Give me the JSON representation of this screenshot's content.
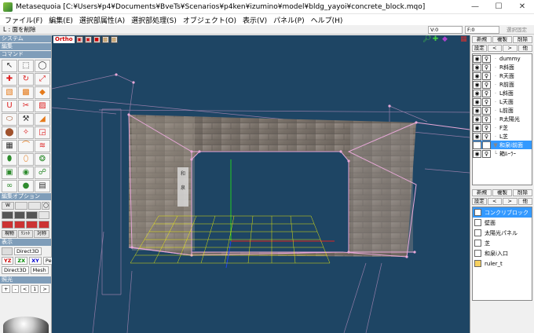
{
  "window": {
    "title": "Metasequoia [C:¥Users¥p4¥Documents¥BveTs¥Scenarios¥p4ken¥izumino¥model¥bldg_yayoi¥concrete_block.mqo]",
    "minimize_icon": "minimize-icon",
    "maximize_icon": "maximize-icon",
    "close_icon": "close-icon"
  },
  "menubar": {
    "items": [
      "ファイル(F)",
      "編集(E)",
      "選択部属性(A)",
      "選択部処理(S)",
      "オブジェクト(O)",
      "表示(V)",
      "パネル(P)",
      "ヘルプ(H)"
    ]
  },
  "statusbar": {
    "text": "L : 面を削除",
    "field_v": "V:0",
    "field_f": "F:0",
    "lock_label": "選択固定"
  },
  "left_panel": {
    "sections": {
      "system": "システム",
      "edit": "編集",
      "command": "コマンド",
      "edit_option": "編集オプション",
      "display": "表示",
      "lighting": "照光"
    },
    "tool_labels": [
      "S",
      "R",
      "G",
      "V",
      "C",
      "T",
      "A",
      "B",
      "F",
      "U",
      "K",
      "E",
      "",
      "",
      "",
      "",
      "",
      "",
      "",
      "",
      "",
      "",
      "",
      "",
      "",
      "",
      "",
      "",
      "",
      ""
    ],
    "option_rows": [
      [
        "W",
        "",
        ""
      ],
      [
        "",
        "",
        ""
      ],
      [
        "",
        "",
        ""
      ]
    ],
    "option_row2": [
      "現物",
      "ﾘｼｯﾄ",
      "対称"
    ],
    "display_btn": "Direct3D",
    "axes": [
      "YZ",
      "ZX",
      "XY",
      "Per"
    ],
    "render_btns": [
      "Direct3D",
      "Mesh"
    ],
    "lighting_controls": [
      "+",
      "-",
      "<",
      "1",
      ">"
    ]
  },
  "viewport": {
    "ortho_label": "Ortho",
    "background_color": "#1e4564",
    "wireframe_color": "#e8a8d8",
    "grid_color": "#ffff00"
  },
  "object_panel": {
    "buttons_row1": [
      "新規",
      "複製",
      "削除"
    ],
    "buttons_row2": [
      "設定",
      "<",
      ">",
      "他"
    ],
    "objects": [
      {
        "name": "dummy",
        "selected": false,
        "child": false
      },
      {
        "name": "R斜面",
        "selected": false,
        "child": false
      },
      {
        "name": "R天面",
        "selected": false,
        "child": false
      },
      {
        "name": "R前面",
        "selected": false,
        "child": false
      },
      {
        "name": "L斜面",
        "selected": false,
        "child": false
      },
      {
        "name": "L天面",
        "selected": false,
        "child": false
      },
      {
        "name": "L前面",
        "selected": false,
        "child": false
      },
      {
        "name": "R太陽光",
        "selected": false,
        "child": false
      },
      {
        "name": "F芝",
        "selected": false,
        "child": false
      },
      {
        "name": "L芝",
        "selected": false,
        "child": false
      },
      {
        "name": "和泉i前面",
        "selected": true,
        "child": false
      },
      {
        "name": "箱ﾙｰﾗｰ",
        "selected": false,
        "child": true
      }
    ]
  },
  "material_panel": {
    "buttons_row1": [
      "新規",
      "複製",
      "削除"
    ],
    "buttons_row2": [
      "設定",
      "<",
      ">",
      "他"
    ],
    "materials": [
      {
        "name": "コンクリブロック",
        "color": "#ffffff",
        "selected": true
      },
      {
        "name": "壁面",
        "color": "#ffffff",
        "selected": false
      },
      {
        "name": "太陽光パネル",
        "color": "#ffffff",
        "selected": false
      },
      {
        "name": "芝",
        "color": "#ffffff",
        "selected": false
      },
      {
        "name": "和泉i入口",
        "color": "#ffffff",
        "selected": false
      },
      {
        "name": "ruler_t",
        "color": "#f5d060",
        "selected": false
      }
    ]
  }
}
